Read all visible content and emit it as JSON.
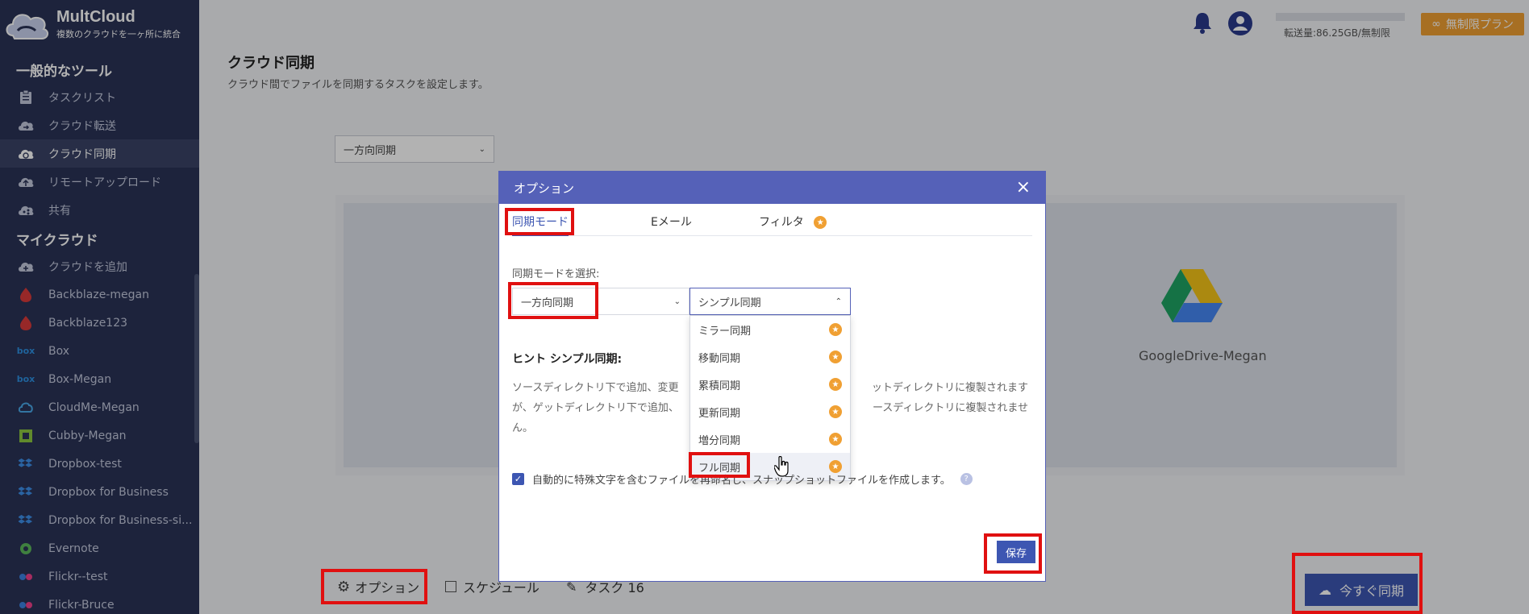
{
  "brand": {
    "name": "MultCloud",
    "tagline": "複数のクラウドを一ヶ所に統合"
  },
  "sidebar": {
    "general_title": "一般的なツール",
    "general_items": [
      {
        "label": "タスクリスト",
        "icon": "clipboard-icon"
      },
      {
        "label": "クラウド転送",
        "icon": "cloud-transfer-icon"
      },
      {
        "label": "クラウド同期",
        "icon": "cloud-sync-icon",
        "active": true
      },
      {
        "label": "リモートアップロード",
        "icon": "cloud-upload-icon"
      },
      {
        "label": "共有",
        "icon": "share-icon"
      }
    ],
    "clouds_title": "マイクラウド",
    "cloud_items": [
      {
        "label": "クラウドを追加",
        "icon": "add-cloud-icon"
      },
      {
        "label": "Backblaze-megan",
        "icon": "backblaze-icon"
      },
      {
        "label": "Backblaze123",
        "icon": "backblaze-icon"
      },
      {
        "label": "Box",
        "icon": "box-icon"
      },
      {
        "label": "Box-Megan",
        "icon": "box-icon"
      },
      {
        "label": "CloudMe-Megan",
        "icon": "cloudme-icon"
      },
      {
        "label": "Cubby-Megan",
        "icon": "cubby-icon"
      },
      {
        "label": "Dropbox-test",
        "icon": "dropbox-icon"
      },
      {
        "label": "Dropbox for Business",
        "icon": "dropbox-icon"
      },
      {
        "label": "Dropbox for Business-si...",
        "icon": "dropbox-icon"
      },
      {
        "label": "Evernote",
        "icon": "evernote-icon"
      },
      {
        "label": "Flickr--test",
        "icon": "flickr-icon"
      },
      {
        "label": "Flickr-Bruce",
        "icon": "flickr-icon"
      }
    ]
  },
  "header": {
    "quota_text": "転送量:86.25GB/無制限",
    "plan_label": "無制限プラン"
  },
  "main": {
    "title": "クラウド同期",
    "subtitle": "クラウド間でファイルを同期するタスクを設定します。",
    "mode_select": "一方向同期",
    "target_cloud": "GoogleDrive-Megan",
    "options_label": "オプション",
    "schedule_label": "スケジュール",
    "task_label": "タスク 16",
    "sync_now_label": "今すぐ同期"
  },
  "modal": {
    "title": "オプション",
    "tabs": [
      "同期モード",
      "Eメール",
      "フィルタ"
    ],
    "select_label": "同期モードを選択:",
    "mode_value": "一方向同期",
    "submode_value": "シンプル同期",
    "dropdown_options": [
      "ミラー同期",
      "移動同期",
      "累積同期",
      "更新同期",
      "増分同期",
      "フル同期"
    ],
    "hint_title": "ヒント シンプル同期:",
    "hint_text_1": "ソースディレクトリ下で追加、変更",
    "hint_text_1b": "ットディレクトリに複製されます",
    "hint_text_2": "が、ゲットディレクトリ下で追加、",
    "hint_text_2b": "ースディレクトリに複製されませ",
    "hint_text_3": "ん。",
    "checkbox_label": "自動的に特殊文字を含むファイルを再命名し、スナップショットファイルを作成します。",
    "save_label": "保存"
  },
  "colors": {
    "sidebar": "#2a3356",
    "accent": "#3d56b2",
    "modal_head": "#5561b8",
    "premium": "#f0a033",
    "highlight": "#e01010"
  }
}
